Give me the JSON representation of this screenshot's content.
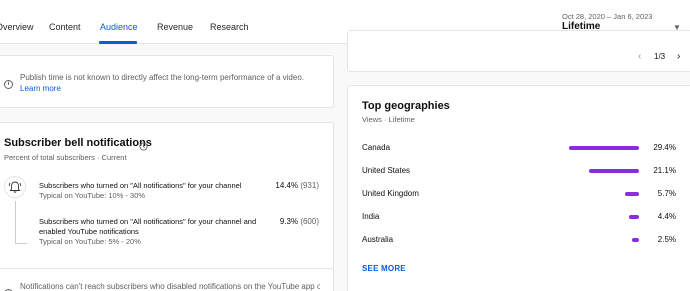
{
  "tabs": [
    "Overview",
    "Content",
    "Audience",
    "Revenue",
    "Research"
  ],
  "header": {
    "date_range": "Oct 28, 2020 – Jan 6, 2023",
    "period": "Lifetime"
  },
  "publish_note": {
    "text": "Publish time is not known to directly affect the long-term performance of a video.",
    "link": "Learn more"
  },
  "bell": {
    "title": "Subscriber bell notifications",
    "subtitle": "Percent of total subscribers · Current",
    "rows": [
      {
        "main": "Subscribers who turned on \"All notifications\" for your channel",
        "typical": "Typical on YouTube: 10% - 30%",
        "pct": "14.4%",
        "count": "(931)"
      },
      {
        "main": "Subscribers who turned on \"All notifications\" for your channel and enabled YouTube notifications",
        "typical": "Typical on YouTube: 5% - 20%",
        "pct": "9.3%",
        "count": "(600)"
      }
    ],
    "footnote": "Notifications can't reach subscribers who disabled notifications on the YouTube app or"
  },
  "pager": {
    "label": "1/3"
  },
  "geo": {
    "title": "Top geographies",
    "subtitle": "Views · Lifetime",
    "see_more": "SEE MORE",
    "bar_color": "#8a2be2"
  },
  "chart_data": {
    "type": "bar",
    "title": "Top geographies",
    "categories": [
      "Canada",
      "United States",
      "United Kingdom",
      "India",
      "Australia"
    ],
    "values": [
      29.4,
      21.1,
      5.7,
      4.4,
      2.5
    ],
    "labels": [
      "29.4%",
      "21.1%",
      "5.7%",
      "4.4%",
      "2.5%"
    ]
  }
}
